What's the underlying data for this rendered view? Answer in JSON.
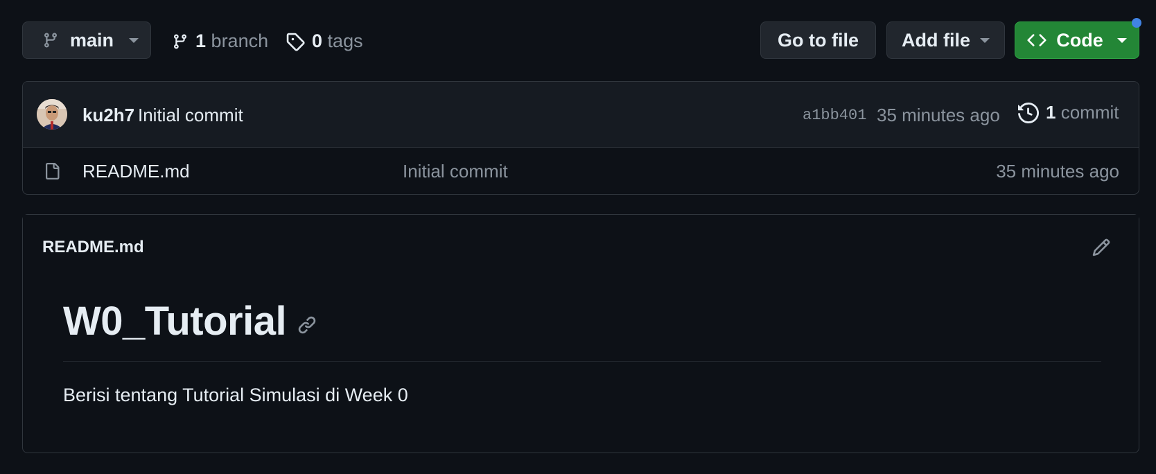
{
  "toolbar": {
    "branch_name": "main",
    "branch_count": "1",
    "branch_label": "branch",
    "tag_count": "0",
    "tag_label": "tags",
    "go_to_file": "Go to file",
    "add_file": "Add file",
    "code": "Code"
  },
  "latest_commit": {
    "author": "ku2h7",
    "message": "Initial commit",
    "sha": "a1bb401",
    "time": "35 minutes ago",
    "commit_count": "1",
    "commit_label": "commit"
  },
  "files": [
    {
      "name": "README.md",
      "last_commit": "Initial commit",
      "time": "35 minutes ago"
    }
  ],
  "readme": {
    "filename": "README.md",
    "heading": "W0_Tutorial",
    "paragraph": "Berisi tentang Tutorial Simulasi di Week 0"
  },
  "colors": {
    "background": "#0d1117",
    "code_button": "#238636",
    "notification_dot": "#4184e4"
  }
}
